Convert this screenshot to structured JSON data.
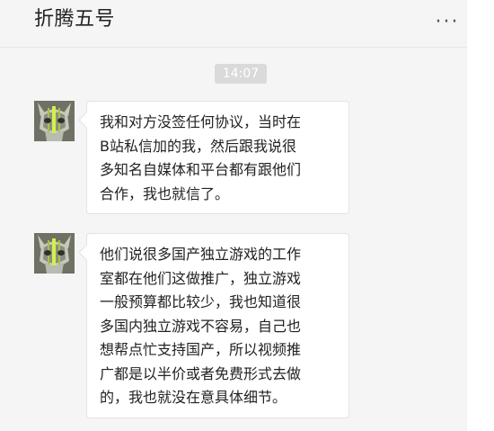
{
  "chat": {
    "contact_name": "折腾五号",
    "more_icon": "more-icon",
    "time": "14:07",
    "messages": [
      {
        "sender_avatar": "cat-avatar-icon",
        "text": "我和对方没签任何协议，当时在\nB站私信加的我，然后跟我说很\n多知名自媒体和平台都有跟他们\n合作，我也就信了。"
      },
      {
        "sender_avatar": "cat-avatar-icon",
        "text": "他们说很多国产独立游戏的工作\n室都在他们这做推广，独立游戏\n一般预算都比较少，我也知道很\n多国内独立游戏不容易，自己也\n想帮点忙支持国产，所以视频推\n广都是以半价或者免费形式去做\n的，我也就没在意具体细节。"
      }
    ]
  },
  "colors": {
    "window_background": "#f5f5f5",
    "bubble_background": "#ffffff",
    "avatar_background": "#6f7165",
    "accent_stripe": "#d6f04a",
    "text": "#222222"
  }
}
